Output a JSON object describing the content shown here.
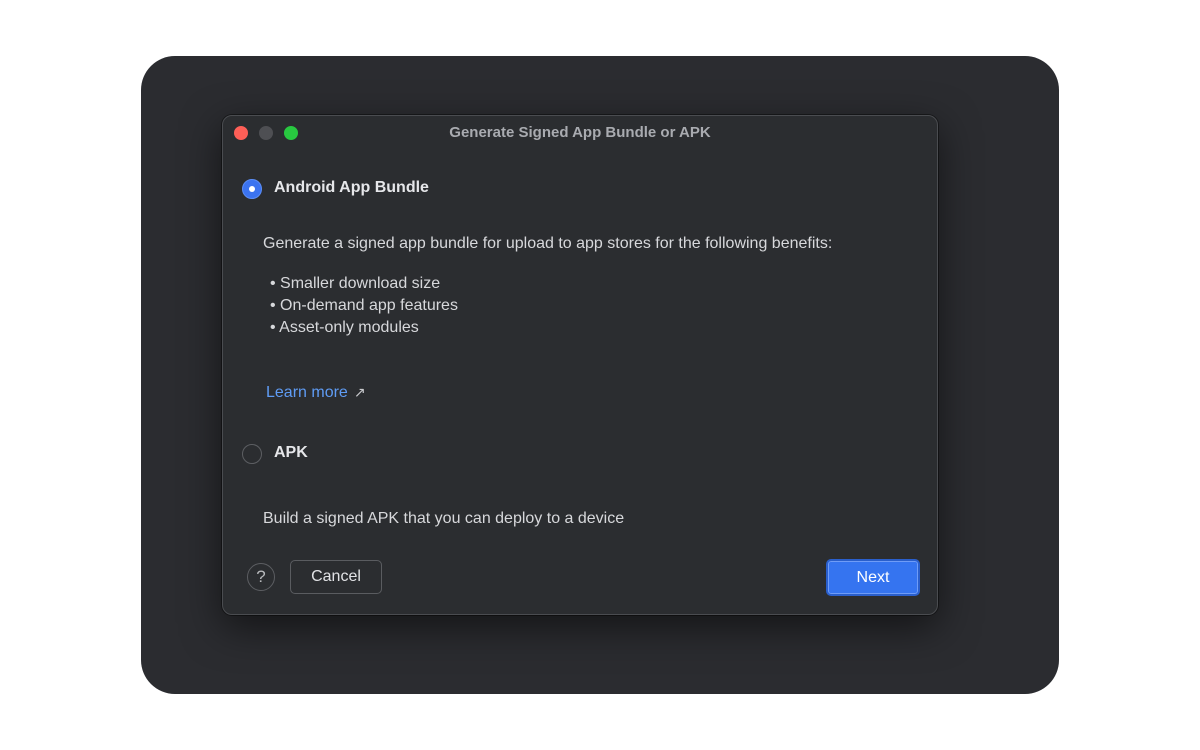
{
  "window": {
    "title": "Generate Signed App Bundle or APK"
  },
  "options": {
    "bundle": {
      "label": "Android App Bundle",
      "selected": true,
      "description": "Generate a signed app bundle for upload to app stores for the following benefits:",
      "benefits": [
        "• Smaller download size",
        "• On-demand app features",
        "• Asset-only modules"
      ],
      "learn_more": "Learn more"
    },
    "apk": {
      "label": "APK",
      "selected": false,
      "description": "Build a signed APK that you can deploy to a device"
    }
  },
  "footer": {
    "help_glyph": "?",
    "cancel_label": "Cancel",
    "next_label": "Next"
  },
  "icons": {
    "external_link": "↗"
  },
  "colors": {
    "accent": "#3574f0",
    "link": "#5f9cf5",
    "dialog_bg": "#2b2d30"
  }
}
